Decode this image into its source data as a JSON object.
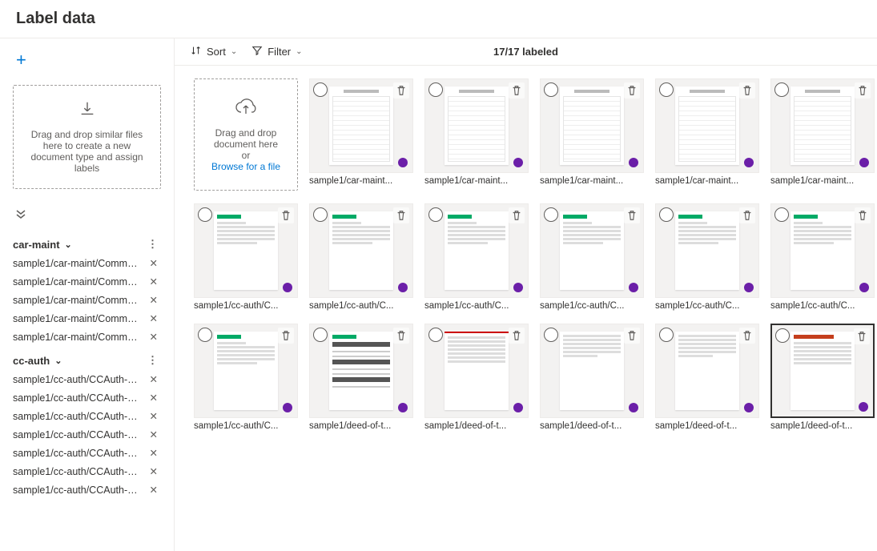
{
  "page_title": "Label data",
  "sidebar": {
    "dropzone_text": "Drag and drop similar files here to create a new document type and assign labels",
    "groups": [
      {
        "name": "car-maint",
        "files": [
          "sample1/car-maint/Comme...",
          "sample1/car-maint/Comme...",
          "sample1/car-maint/Comme...",
          "sample1/car-maint/Comme...",
          "sample1/car-maint/Comme..."
        ]
      },
      {
        "name": "cc-auth",
        "files": [
          "sample1/cc-auth/CCAuth-1....",
          "sample1/cc-auth/CCAuth-2....",
          "sample1/cc-auth/CCAuth-3....",
          "sample1/cc-auth/CCAuth-4....",
          "sample1/cc-auth/CCAuth-5....",
          "sample1/cc-auth/CCAuth-6....",
          "sample1/cc-auth/CCAuth-7...."
        ]
      }
    ]
  },
  "toolbar": {
    "sort_label": "Sort",
    "filter_label": "Filter",
    "counter": "17/17 labeled"
  },
  "main_dropzone": {
    "line1": "Drag and drop document here",
    "or": "or",
    "browse": "Browse for a file"
  },
  "cards": [
    {
      "caption": "sample1/car-maint...",
      "kind": "table",
      "selected": false
    },
    {
      "caption": "sample1/car-maint...",
      "kind": "table",
      "selected": false
    },
    {
      "caption": "sample1/car-maint...",
      "kind": "table",
      "selected": false
    },
    {
      "caption": "sample1/car-maint...",
      "kind": "table",
      "selected": false
    },
    {
      "caption": "sample1/car-maint...",
      "kind": "table",
      "selected": false
    },
    {
      "caption": "sample1/cc-auth/C...",
      "kind": "letter",
      "selected": false
    },
    {
      "caption": "sample1/cc-auth/C...",
      "kind": "letter",
      "selected": false
    },
    {
      "caption": "sample1/cc-auth/C...",
      "kind": "letter",
      "selected": false
    },
    {
      "caption": "sample1/cc-auth/C...",
      "kind": "letter",
      "selected": false
    },
    {
      "caption": "sample1/cc-auth/C...",
      "kind": "letter",
      "selected": false
    },
    {
      "caption": "sample1/cc-auth/C...",
      "kind": "letter",
      "selected": false
    },
    {
      "caption": "sample1/cc-auth/C...",
      "kind": "letter",
      "selected": false
    },
    {
      "caption": "sample1/deed-of-t...",
      "kind": "form",
      "selected": false
    },
    {
      "caption": "sample1/deed-of-t...",
      "kind": "redtop",
      "selected": false
    },
    {
      "caption": "sample1/deed-of-t...",
      "kind": "text",
      "selected": false
    },
    {
      "caption": "sample1/deed-of-t...",
      "kind": "text",
      "selected": false
    },
    {
      "caption": "sample1/deed-of-t...",
      "kind": "redlogo",
      "selected": true
    }
  ]
}
